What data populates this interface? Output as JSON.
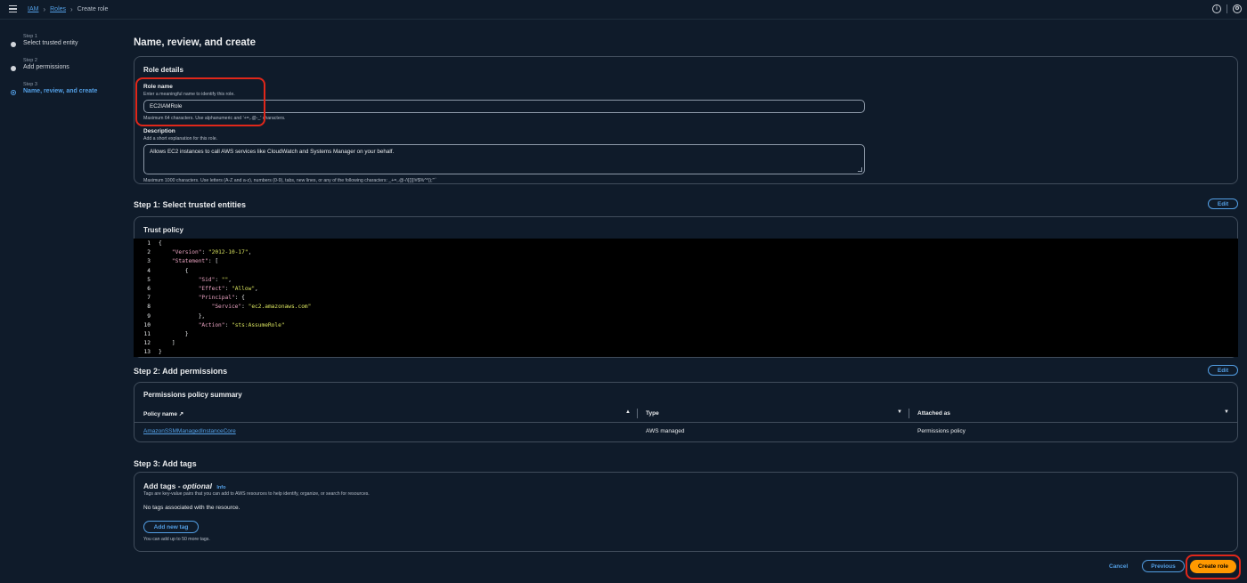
{
  "breadcrumb": {
    "items": [
      "IAM",
      "Roles"
    ],
    "current": "Create role"
  },
  "steps": [
    {
      "num": "Step 1",
      "label": "Select trusted entity"
    },
    {
      "num": "Step 2",
      "label": "Add permissions"
    },
    {
      "num": "Step 3",
      "label": "Name, review, and create"
    }
  ],
  "page": {
    "title": "Name, review, and create"
  },
  "role_details": {
    "header": "Role details",
    "role_name_label": "Role name",
    "role_name_desc": "Enter a meaningful name to identify this role.",
    "role_name_value": "EC2IAMRole",
    "role_name_hint": "Maximum 64 characters. Use alphanumeric and '+=,.@-_' characters.",
    "description_label": "Description",
    "description_desc": "Add a short explanation for this role.",
    "description_value": "Allows EC2 instances to call AWS services like CloudWatch and Systems Manager on your behalf.",
    "description_hint": "Maximum 1000 characters. Use letters (A-Z and a-z), numbers (0-9), tabs, new lines, or any of the following characters: _+=,.@-/\\[{}]!#$%^*();\"'`"
  },
  "step1": {
    "title": "Step 1: Select trusted entities",
    "edit": "Edit",
    "panel_header": "Trust policy",
    "line_numbers": [
      "1",
      "2",
      "3",
      "4",
      "5",
      "6",
      "7",
      "8",
      "9",
      "10",
      "11",
      "12",
      "13"
    ]
  },
  "step2": {
    "title": "Step 2: Add permissions",
    "edit": "Edit",
    "panel_header": "Permissions policy summary",
    "columns": [
      "Policy name",
      "Type",
      "Attached as"
    ],
    "rows": [
      {
        "policy": "AmazonSSMManagedInstanceCore",
        "type": "AWS managed",
        "attached": "Permissions policy"
      }
    ]
  },
  "step3": {
    "title": "Step 3: Add tags",
    "panel_header": "Add tags -",
    "optional": "optional",
    "info": "Info",
    "desc": "Tags are key-value pairs that you can add to AWS resources to help identify, organize, or search for resources.",
    "empty": "No tags associated with the resource.",
    "add_button": "Add new tag",
    "limit": "You can add up to 50 more tags."
  },
  "footer": {
    "cancel": "Cancel",
    "previous": "Previous",
    "create": "Create role"
  },
  "colors": {
    "accent": "#539fe5",
    "primary": "#ff9900",
    "highlight": "#e0271a",
    "background": "#0f1b2a"
  },
  "icons": {
    "menu": "hamburger-icon",
    "info": "info-circle-icon",
    "settings": "gear-icon",
    "external": "external-link-icon"
  }
}
